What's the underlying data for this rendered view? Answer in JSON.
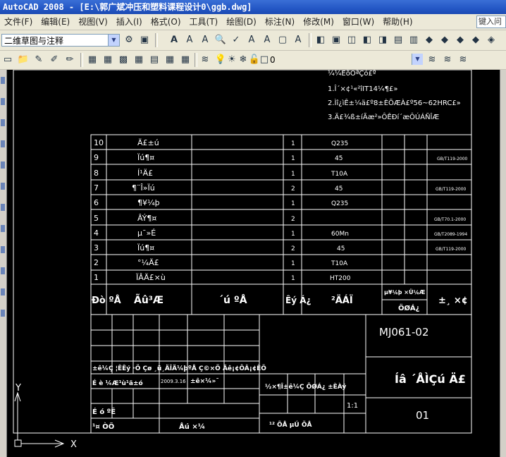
{
  "window": {
    "title": "AutoCAD 2008 - [E:\\郭广斌冲压和塑料课程设计0\\ggb.dwg]"
  },
  "menu": {
    "items": [
      "文件(F)",
      "编辑(E)",
      "视图(V)",
      "插入(I)",
      "格式(O)",
      "工具(T)",
      "绘图(D)",
      "标注(N)",
      "修改(M)",
      "窗口(W)",
      "帮助(H)"
    ],
    "help_search": "键入问"
  },
  "toolbar": {
    "workspace": "二维草图与注释",
    "layer_value": "0"
  },
  "drawing": {
    "notes": [
      "¼¼ÊõÒªÇó£º",
      "1.Î´×¢¹«²îIT14¼¶£»",
      "2.Ìî¿ìÊ±¼ä£º8±ÈÕÆÀ£º56~62HRC£»",
      "3.Ä£¾ß±íÃæ²»ÔÊÐí´æÔÚÁÑÎÆ"
    ],
    "parts": [
      {
        "no": "10",
        "name": "Ä£±ú",
        "qty": "1",
        "mat": "Q235",
        "std": ""
      },
      {
        "no": "9",
        "name": "Ïú¶¤",
        "qty": "1",
        "mat": "45",
        "std": "GB/T119-2000"
      },
      {
        "no": "8",
        "name": "Í¹Ä£",
        "qty": "1",
        "mat": "T10A",
        "std": ""
      },
      {
        "no": "7",
        "name": "¶¨Î»Ïú",
        "qty": "2",
        "mat": "45",
        "std": "GB/T119-2000"
      },
      {
        "no": "6",
        "name": "¶¥¼þ",
        "qty": "1",
        "mat": "Q235",
        "std": ""
      },
      {
        "no": "5",
        "name": "ÂÝ¶¤",
        "qty": "2",
        "mat": "",
        "std": "GB/T70.1-2000"
      },
      {
        "no": "4",
        "name": "µ¯»É",
        "qty": "1",
        "mat": "60Mn",
        "std": "GB/T2089-1994"
      },
      {
        "no": "3",
        "name": "Ïú¶¤",
        "qty": "2",
        "mat": "45",
        "std": "GB/T119-2000"
      },
      {
        "no": "2",
        "name": "°¼Ä£",
        "qty": "1",
        "mat": "T10A",
        "std": ""
      },
      {
        "no": "1",
        "name": "ÏÂÄ£×ù",
        "qty": "1",
        "mat": "HT200",
        "std": ""
      }
    ],
    "header": {
      "no": "Ðò ºÅ",
      "code": "Ãû³Æ",
      "name": "´ú ºÅ",
      "qty": "Êý Á¿",
      "mat": "²ÄÁÏ",
      "unit_weight": "µ¥¼þ ×Ü¼Æ",
      "weight": "ÖØÁ¿",
      "remark": "±¸ ×¢"
    },
    "title_block": {
      "drawing_no": "MJ061-02",
      "part_name": "Íâ ´ÅÌÇú Ä£",
      "sheet": "01",
      "scale": "1:1",
      "row_mark": "±ê¼Ç ¦ÊÊý  ·Ö Çø  ¸ü¸ÄÎÄ¼þºÅ Ç©×Ö Äê¡¢ÔÂ¡¢ÈÕ",
      "designer": "É è ¼Æ¹ù¹ã±ó",
      "date": "2009.3.16",
      "std_label": "±ê×¼»¯",
      "stage_label": "½×¶Î±ê¼Ç  ÖØÁ¿ ±ÈÀý",
      "review": "É ó ºË",
      "craft": "¹¤ ÒÕ",
      "approve": "Åú ×¼",
      "sheets": "¹²  ÕÅ  µÚ  ÕÅ"
    },
    "ucs": {
      "x": "X",
      "y": "Y"
    }
  },
  "colors": {
    "canvas": "#000000",
    "lines": "#ffffff",
    "menubar": "#ece9d8"
  }
}
